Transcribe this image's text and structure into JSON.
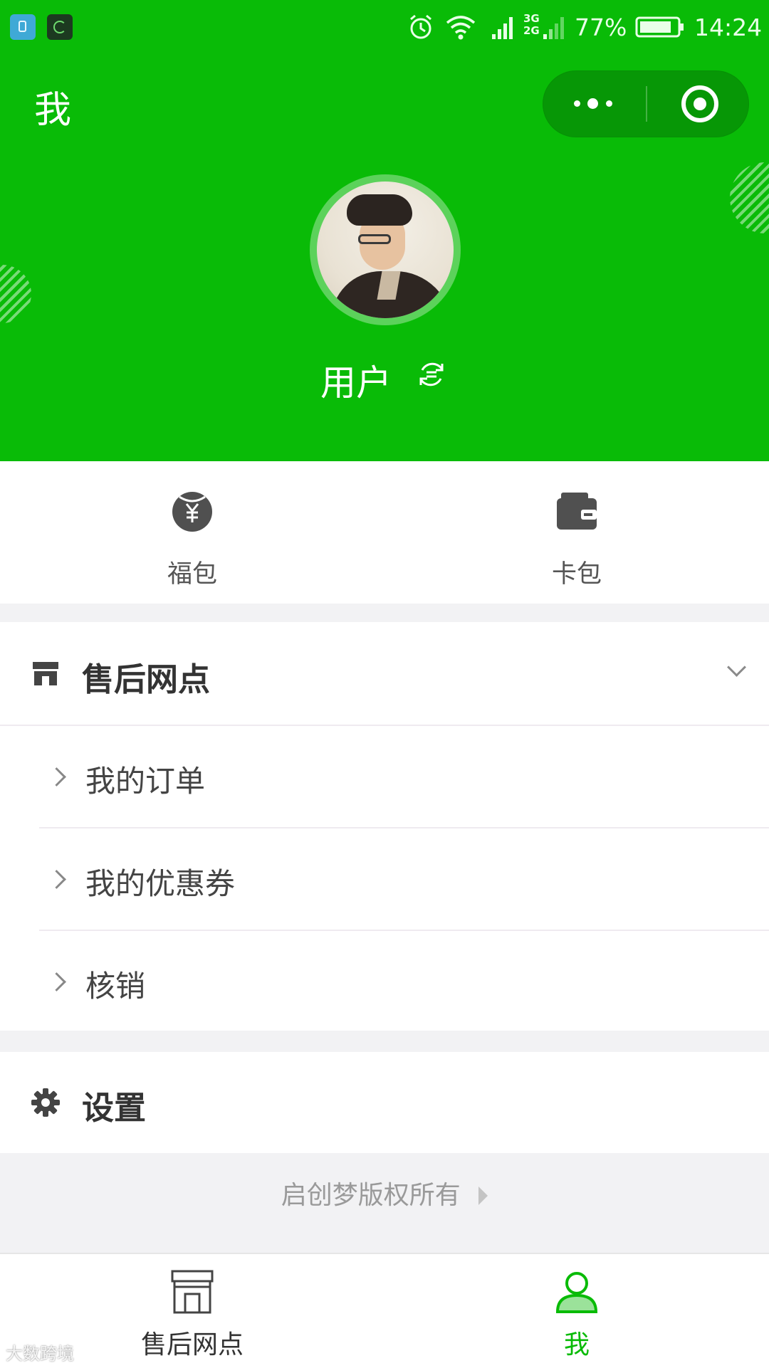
{
  "status_bar": {
    "battery": "77%",
    "time": "14:24",
    "network_top": "3G",
    "network_bottom": "2G"
  },
  "nav": {
    "title": "我"
  },
  "profile": {
    "username": "用户"
  },
  "wallet": {
    "items": [
      {
        "label": "福包",
        "icon": "red-packet-icon"
      },
      {
        "label": "卡包",
        "icon": "wallet-icon"
      }
    ]
  },
  "sections": {
    "aftersales": {
      "title": "售后网点",
      "icon": "store-icon",
      "items": [
        {
          "label": "我的订单"
        },
        {
          "label": "我的优惠券"
        },
        {
          "label": "核销"
        }
      ]
    },
    "settings": {
      "title": "设置",
      "icon": "gear-icon"
    }
  },
  "footer": {
    "copyright": "启创梦版权所有"
  },
  "tabbar": {
    "tabs": [
      {
        "label": "售后网点",
        "icon": "store-tab-icon",
        "active": false
      },
      {
        "label": "我",
        "icon": "person-icon",
        "active": true
      }
    ],
    "active_color": "#09bb07",
    "inactive_color": "#333333"
  },
  "watermark": "大数跨境",
  "colors": {
    "brand_green": "#09bb07",
    "capsule_green": "#079706"
  }
}
